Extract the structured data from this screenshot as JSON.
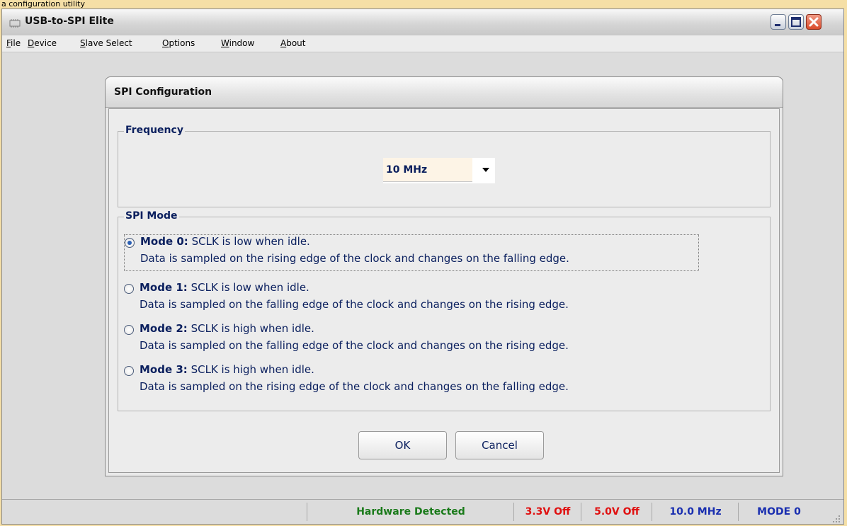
{
  "caption": "a configuration utility",
  "window": {
    "title": "USB-to-SPI Elite",
    "controls": [
      "minimize",
      "maximize",
      "close"
    ]
  },
  "menu": [
    {
      "label": "File",
      "underline": "F",
      "rest": "ile"
    },
    {
      "label": "Device",
      "underline": "D",
      "rest": "evice"
    },
    {
      "label": "Slave Select",
      "underline": "S",
      "rest": "lave Select"
    },
    {
      "label": "Options",
      "underline": "O",
      "rest": "ptions"
    },
    {
      "label": "Window",
      "underline": "W",
      "rest": "indow"
    },
    {
      "label": "About",
      "underline": "A",
      "rest": "bout"
    }
  ],
  "dialog": {
    "title": "SPI Configuration",
    "frequency": {
      "legend": "Frequency",
      "selected": "10 MHz"
    },
    "spi_mode": {
      "legend": "SPI Mode",
      "selected_index": 0,
      "modes": [
        {
          "name": "Mode 0:",
          "idle": "SCLK is low when idle.",
          "detail": "Data is sampled on the rising edge of the clock and changes on the falling edge."
        },
        {
          "name": "Mode 1:",
          "idle": "SCLK is low when idle.",
          "detail": "Data is sampled on the falling edge of the clock and changes on the rising edge."
        },
        {
          "name": "Mode 2:",
          "idle": "SCLK is high when idle.",
          "detail": "Data is sampled on the falling edge of the clock and changes on the rising edge."
        },
        {
          "name": "Mode 3:",
          "idle": "SCLK is high when idle.",
          "detail": "Data is sampled on the rising edge of the clock and changes on the falling edge."
        }
      ]
    },
    "ok_label": "OK",
    "cancel_label": "Cancel"
  },
  "status": {
    "hardware": "Hardware Detected",
    "v33": "3.3V Off",
    "v50": "5.0V Off",
    "freq": "10.0 MHz",
    "mode": "MODE 0",
    "colors": {
      "hardware": "#1a7a1a",
      "power": "#e01010",
      "info": "#1a2fb0"
    }
  }
}
